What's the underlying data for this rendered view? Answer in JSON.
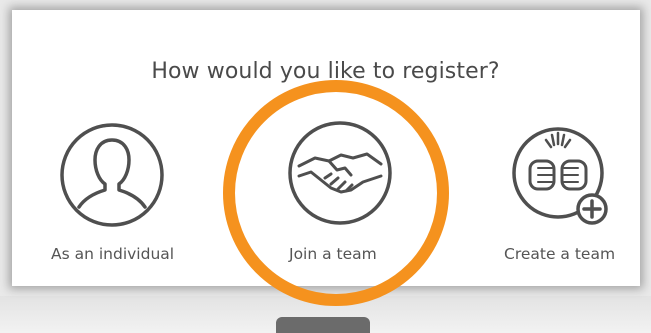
{
  "dialog": {
    "title": "How would you like to register?"
  },
  "options": [
    {
      "label": "As an individual",
      "icon": "person-icon"
    },
    {
      "label": "Join a team",
      "icon": "handshake-icon"
    },
    {
      "label": "Create a team",
      "icon": "fist-bump-add-icon"
    }
  ],
  "colors": {
    "highlight": "#f5921e",
    "icon_stroke": "#4f4f4f",
    "text": "#555555"
  }
}
